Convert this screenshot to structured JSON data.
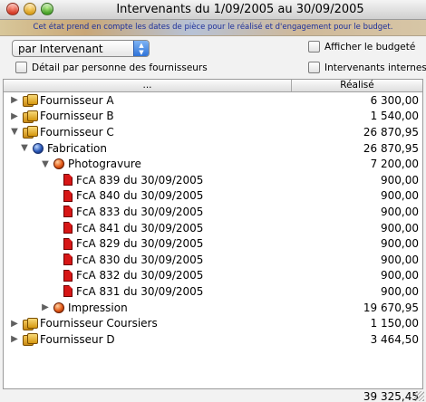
{
  "window": {
    "title": "Intervenants du 1/09/2005 au 30/09/2005"
  },
  "banner": {
    "note": "Cet état prend en compte les dates de pièce pour le réalisé et d'engagement pour le budget."
  },
  "controls": {
    "group_by_value": "par Intervenant",
    "afficher_budgete_label": "Afficher le budgeté",
    "afficher_budgete_checked": false,
    "detail_label": "Détail par personne des fournisseurs",
    "detail_checked": false,
    "internes_label": "Intervenants internes",
    "internes_checked": false
  },
  "table": {
    "columns": [
      "...",
      "Réalisé"
    ],
    "rows": [
      {
        "level": 0,
        "toggle": "collapsed",
        "icon": "supplier-icon",
        "label": "Fournisseur A",
        "amount": "6 300,00"
      },
      {
        "level": 0,
        "toggle": "collapsed",
        "icon": "supplier-icon",
        "label": "Fournisseur B",
        "amount": "1 540,00"
      },
      {
        "level": 0,
        "toggle": "expanded",
        "icon": "supplier-icon",
        "label": "Fournisseur C",
        "amount": "26 870,95"
      },
      {
        "level": 1,
        "toggle": "expanded",
        "icon": "globe-icon",
        "label": "Fabrication",
        "amount": "26 870,95"
      },
      {
        "level": 2,
        "toggle": "expanded",
        "icon": "ball-icon",
        "label": "Photogravure",
        "amount": "7 200,00"
      },
      {
        "level": 3,
        "toggle": "none",
        "icon": "invoice-icon",
        "label": "FcA 839 du 30/09/2005",
        "amount": "900,00"
      },
      {
        "level": 3,
        "toggle": "none",
        "icon": "invoice-icon",
        "label": "FcA 840 du 30/09/2005",
        "amount": "900,00"
      },
      {
        "level": 3,
        "toggle": "none",
        "icon": "invoice-icon",
        "label": "FcA 833 du 30/09/2005",
        "amount": "900,00"
      },
      {
        "level": 3,
        "toggle": "none",
        "icon": "invoice-icon",
        "label": "FcA 841 du 30/09/2005",
        "amount": "900,00"
      },
      {
        "level": 3,
        "toggle": "none",
        "icon": "invoice-icon",
        "label": "FcA 829 du 30/09/2005",
        "amount": "900,00"
      },
      {
        "level": 3,
        "toggle": "none",
        "icon": "invoice-icon",
        "label": "FcA 830 du 30/09/2005",
        "amount": "900,00"
      },
      {
        "level": 3,
        "toggle": "none",
        "icon": "invoice-icon",
        "label": "FcA 832 du 30/09/2005",
        "amount": "900,00"
      },
      {
        "level": 3,
        "toggle": "none",
        "icon": "invoice-icon",
        "label": "FcA 831 du 30/09/2005",
        "amount": "900,00"
      },
      {
        "level": 2,
        "toggle": "collapsed",
        "icon": "ball-icon",
        "label": "Impression",
        "amount": "19 670,95"
      },
      {
        "level": 0,
        "toggle": "collapsed",
        "icon": "supplier-icon",
        "label": "Fournisseur Coursiers",
        "amount": "1 150,00"
      },
      {
        "level": 0,
        "toggle": "collapsed",
        "icon": "supplier-icon",
        "label": "Fournisseur D",
        "amount": "3 464,50"
      }
    ]
  },
  "footer": {
    "total": "39 325,45"
  },
  "colors": {
    "banner_text": "#1c2f9a",
    "select_accent": "#2f73d8",
    "invoice_red": "#d71616"
  }
}
